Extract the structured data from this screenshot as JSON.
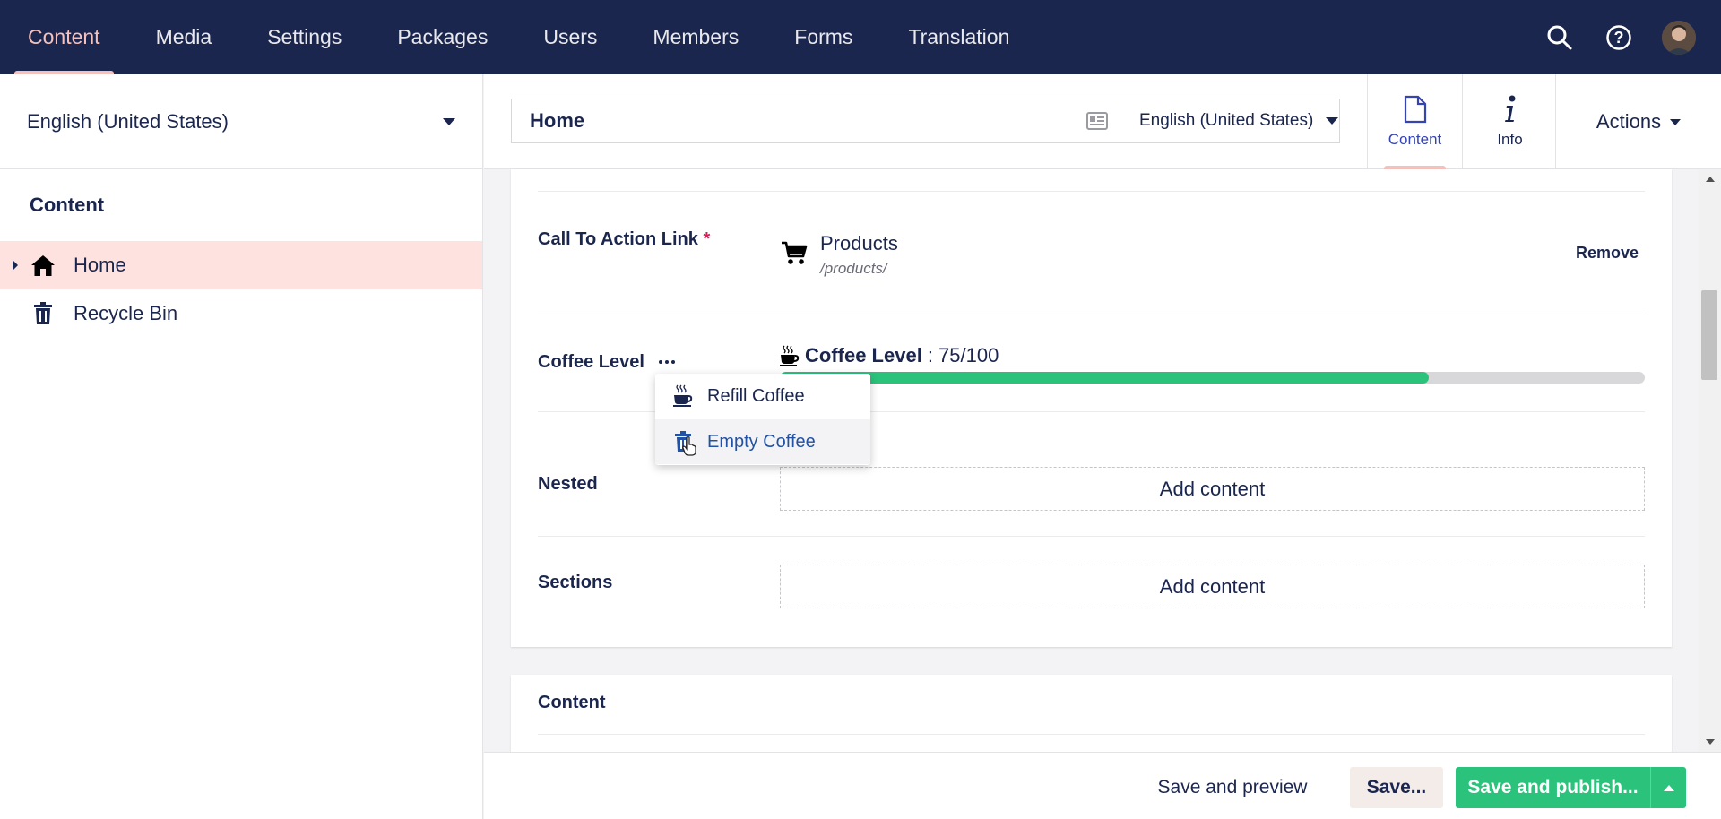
{
  "nav": {
    "sections": [
      "Content",
      "Media",
      "Settings",
      "Packages",
      "Users",
      "Members",
      "Forms",
      "Translation"
    ],
    "active": "Content"
  },
  "sidebar": {
    "language": "English (United States)",
    "title": "Content",
    "tree": [
      {
        "label": "Home",
        "icon": "home-icon",
        "selected": true
      },
      {
        "label": "Recycle Bin",
        "icon": "trash-icon",
        "selected": false
      }
    ]
  },
  "header": {
    "node_name": "Home",
    "variant": "English (United States)",
    "tabs": [
      {
        "label": "Content",
        "icon": "document-icon",
        "active": true
      },
      {
        "label": "Info",
        "icon": "info-icon",
        "active": false
      }
    ],
    "actions_label": "Actions"
  },
  "properties": {
    "cta": {
      "label": "Call To Action Link",
      "required_mark": "*",
      "link_title": "Products",
      "link_url": "/products/",
      "remove_label": "Remove"
    },
    "coffee": {
      "label": "Coffee Level",
      "value_label": "Coffee Level",
      "value_text": ": 75/100",
      "level": 0.75
    },
    "nested": {
      "label": "Nested",
      "add_label": "Add content"
    },
    "sections": {
      "label": "Sections",
      "add_label": "Add content"
    }
  },
  "dropdown": {
    "items": [
      {
        "label": "Refill Coffee",
        "icon": "coffee-cup-icon"
      },
      {
        "label": "Empty Coffee",
        "icon": "trash-icon"
      }
    ]
  },
  "content_group": {
    "title": "Content"
  },
  "footer": {
    "preview_label": "Save and preview",
    "save_label": "Save...",
    "publish_label": "Save and publish..."
  },
  "colors": {
    "topbar": "#1b264f",
    "accent": "#f5c1bc",
    "primary_button": "#2bc37c",
    "selected_tree_bg": "#fde2df"
  }
}
